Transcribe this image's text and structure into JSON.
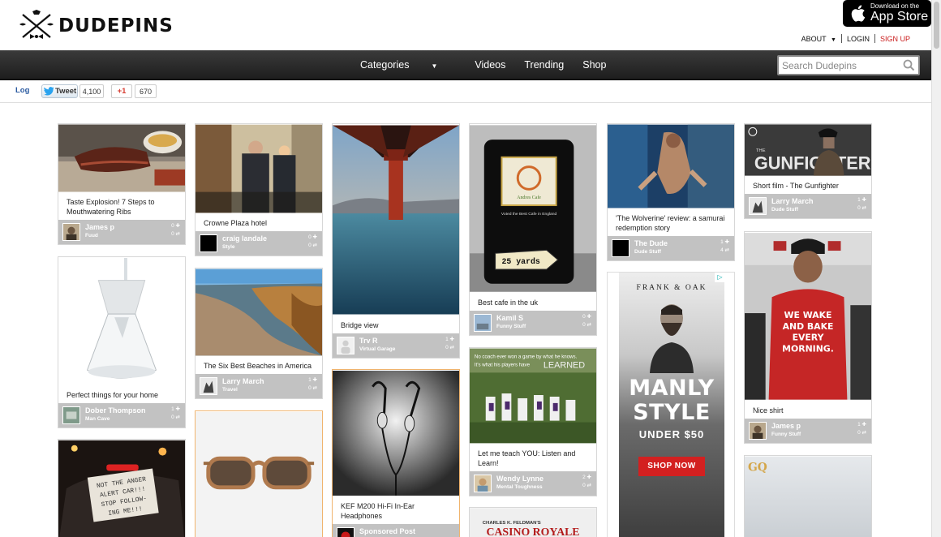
{
  "brand": {
    "name": "DUDEPINS"
  },
  "appstore": {
    "line1": "Download on the",
    "line2": "App Store"
  },
  "topnav": {
    "about": "ABOUT",
    "login": "LOGIN",
    "signup": "SIGN UP"
  },
  "navbar": {
    "items": [
      "Categories",
      "Videos",
      "Trending",
      "Shop"
    ],
    "search_placeholder": "Search Dudepins"
  },
  "sharebar": {
    "log": "Log",
    "tweet": "Tweet",
    "tweet_count": "4,100",
    "gplus": "+1",
    "gplus_count": "670"
  },
  "colors": {
    "accent_red": "#c91a1a",
    "navbar_bg": "#262626",
    "card_footer": "#c2c2c2"
  },
  "pins": [
    {
      "caption": "Taste Explosion! 7 Steps to Mouthwatering Ribs",
      "user": "James p",
      "category": "Fuud",
      "likes": "0",
      "repins": "0"
    },
    {
      "caption": "Perfect things for your home",
      "user": "Dober Thompson",
      "category": "Man Cave",
      "likes": "1",
      "repins": "0"
    },
    {
      "caption": "Crowne Plaza hotel",
      "user": "craig landale",
      "category": "Style",
      "likes": "0",
      "repins": "0"
    },
    {
      "caption": "The Six Best Beaches in America",
      "user": "Larry March",
      "category": "Travel",
      "likes": "1",
      "repins": "0"
    },
    {
      "caption": "Bridge view",
      "user": "Trv R",
      "category": "Virtual Garage",
      "likes": "1",
      "repins": "0"
    },
    {
      "caption": "KEF M200 Hi-Fi In-Ear Headphones",
      "user": "Sponsored Post",
      "category": "",
      "likes": "",
      "repins": ""
    },
    {
      "caption": "Best cafe in the uk",
      "user": "Kamil S",
      "category": "Funny Stuff",
      "likes": "0",
      "repins": "0"
    },
    {
      "caption": "Let me teach YOU: Listen and Learn!",
      "user": "Wendy Lynne",
      "category": "Mental Toughness",
      "likes": "2",
      "repins": "0"
    },
    {
      "caption": "'The Wolverine' review: a samurai redemption story",
      "user": "The Dude",
      "category": "Dude Stuff",
      "likes": "1",
      "repins": "4"
    },
    {
      "caption": "Short film - The Gunfighter",
      "user": "Larry March",
      "category": "Dude Stuff",
      "likes": "1",
      "repins": "0"
    },
    {
      "caption": "Nice shirt",
      "user": "James p",
      "category": "Funny Stuff",
      "likes": "1",
      "repins": "0"
    }
  ],
  "image_text": {
    "sign_text": "NOT THE ANGER ALERT CAR!!! STOP FOLLOW-ING ME!!!",
    "cafe_name": "Andres Cafe",
    "cafe_tag": "Voted the Best Cafe in England",
    "cafe_distance": "25 yards",
    "meme_text": "No coach ever won a game by what he knows. It's what his players have LEARNED",
    "gunfighter_title": "THE GUNFIGHTER",
    "shirt_text": "WE WAKE AND BAKE EVERY MORNING.",
    "casino_header": "CHARLES K. FELDMAN'S",
    "casino_title": "CASINO ROYALE",
    "gq_logo": "GQ"
  },
  "ad": {
    "brand": "FRANK & OAK",
    "headline_1": "MANLY",
    "headline_2": "STYLE",
    "subline": "UNDER $50",
    "cta": "SHOP NOW"
  }
}
